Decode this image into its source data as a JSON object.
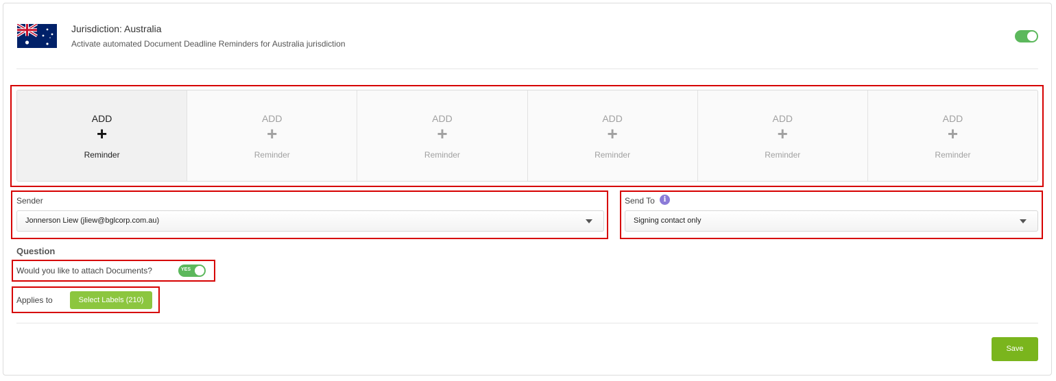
{
  "jurisdiction": {
    "title": "Jurisdiction: Australia",
    "subtitle": "Activate automated Document Deadline Reminders for Australia jurisdiction",
    "enabled": true,
    "flag_icon": "australia-flag-icon"
  },
  "reminders": [
    {
      "add": "ADD",
      "plus": "+",
      "label": "Reminder",
      "active": true
    },
    {
      "add": "ADD",
      "plus": "+",
      "label": "Reminder",
      "active": false
    },
    {
      "add": "ADD",
      "plus": "+",
      "label": "Reminder",
      "active": false
    },
    {
      "add": "ADD",
      "plus": "+",
      "label": "Reminder",
      "active": false
    },
    {
      "add": "ADD",
      "plus": "+",
      "label": "Reminder",
      "active": false
    },
    {
      "add": "ADD",
      "plus": "+",
      "label": "Reminder",
      "active": false
    }
  ],
  "sender": {
    "label": "Sender",
    "value": "Jonnerson Liew (jliew@bglcorp.com.au)"
  },
  "send_to": {
    "label": "Send To",
    "value": "Signing contact only",
    "info_icon": "i"
  },
  "question": {
    "title": "Question",
    "attach_text": "Would you like to attach Documents?",
    "attach_toggle": "YES",
    "applies_to": "Applies to",
    "labels_button": "Select Labels (210)"
  },
  "actions": {
    "save": "Save"
  },
  "colors": {
    "toggle_on": "#5cb85c",
    "label_button": "#8cc63f",
    "save_button": "#7ab51d",
    "highlight": "#d60000",
    "info": "#8b7bd8"
  }
}
